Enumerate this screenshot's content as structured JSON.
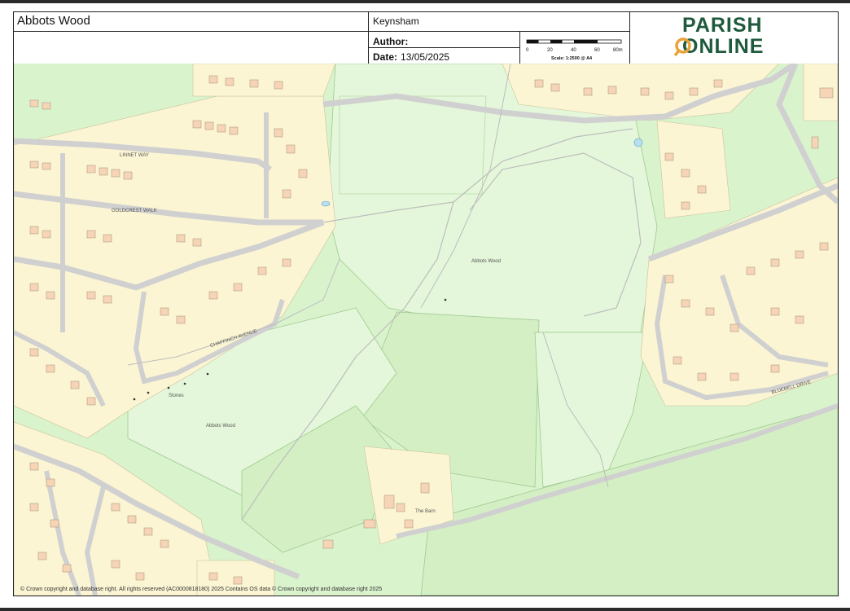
{
  "header": {
    "title": "Abbots Wood",
    "location": "Keynsham",
    "author_label": "Author:",
    "author_value": "",
    "date_label": "Date:",
    "date_value": "13/05/2025"
  },
  "scale_bar": {
    "ticks": [
      "0",
      "20",
      "40",
      "60",
      "80m"
    ],
    "caption": "Scale: 1:2500 @ A4"
  },
  "logo": {
    "line1": "PARISH",
    "line2": "ONLINE",
    "brand_color": "#1f5a3c",
    "accent_color": "#e9a33a",
    "pin_icon": "map-pin-icon"
  },
  "map": {
    "labels": {
      "wood_north": "Abbots Wood",
      "wood_south": "Abbots Wood",
      "linnet_way": "LINNET WAY",
      "goldcrest_walk": "GOLDCREST WALK",
      "chaffinch_avenue": "CHAFFINCH AVENUE",
      "bluebell_drive": "BLUEBELL DRIVE",
      "the_barn": "The Barn",
      "stones": "Stones"
    },
    "colors": {
      "open_space": "#e4f7da",
      "woodland": "#d4efc4",
      "residential": "#fbf5d3",
      "building": "#f6d4b6",
      "road": "#d0d0d0"
    }
  },
  "copyright": "© Crown copyright and database right. All rights reserved (AC0000818180) 2025 Contains OS data © Crown copyright and database right 2025"
}
